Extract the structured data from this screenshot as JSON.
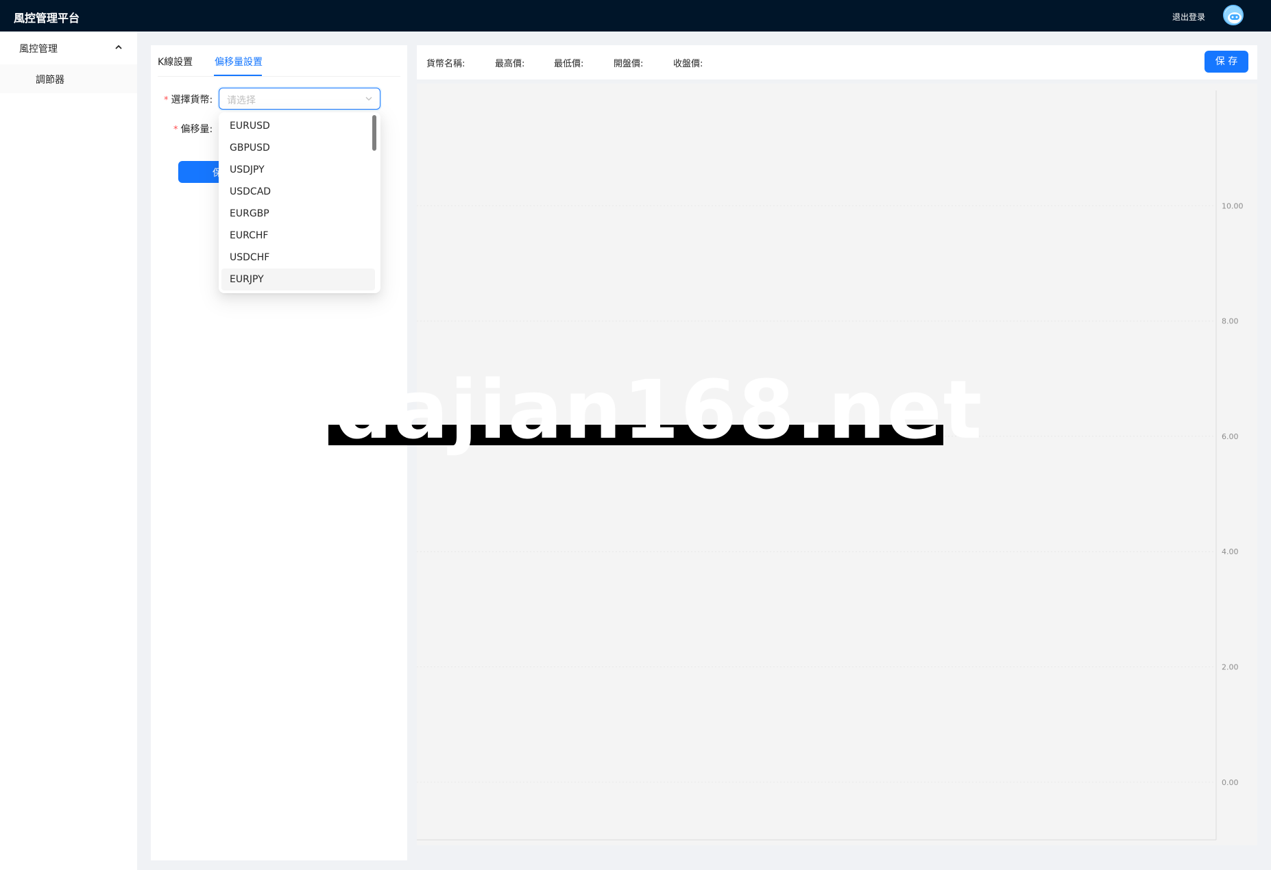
{
  "header": {
    "app_title": "風控管理平台",
    "logout_label": "退出登录",
    "avatar_icon": "robot-avatar-icon"
  },
  "sidebar": {
    "group_label": "風控管理",
    "group_icon": "chevron-up-icon",
    "items": [
      {
        "label": "調節器",
        "selected": true
      }
    ]
  },
  "left_panel": {
    "tabs": [
      {
        "label": "K線設置",
        "active": false
      },
      {
        "label": "偏移量設置",
        "active": true
      }
    ],
    "form": {
      "currency_label": "選擇貨幣:",
      "currency_placeholder": "请选择",
      "offset_label": "偏移量:",
      "required_mark": "*",
      "submit_label": "保"
    },
    "dropdown": {
      "options": [
        "EURUSD",
        "GBPUSD",
        "USDJPY",
        "USDCAD",
        "EURGBP",
        "EURCHF",
        "USDCHF",
        "EURJPY"
      ],
      "hovered_option": "EURJPY"
    }
  },
  "info_bar": {
    "currency_name_label": "貨幣名稱:",
    "high_label": "最高價:",
    "low_label": "最低價:",
    "open_label": "開盤價:",
    "close_label": "收盤價:",
    "save_label": "保 存"
  },
  "chart_data": {
    "type": "line",
    "series": [],
    "y_axis_position": "right",
    "yticks": [
      "0.00",
      "2.00",
      "4.00",
      "6.00",
      "8.00",
      "10.00"
    ],
    "ylim": [
      -1,
      12
    ],
    "grid": true
  },
  "watermark": {
    "text": "dajian168.net"
  },
  "colors": {
    "header_bg": "#001529",
    "primary": "#1677ff",
    "chart_bg": "#f4f4f4",
    "required": "#ff4d4f"
  }
}
